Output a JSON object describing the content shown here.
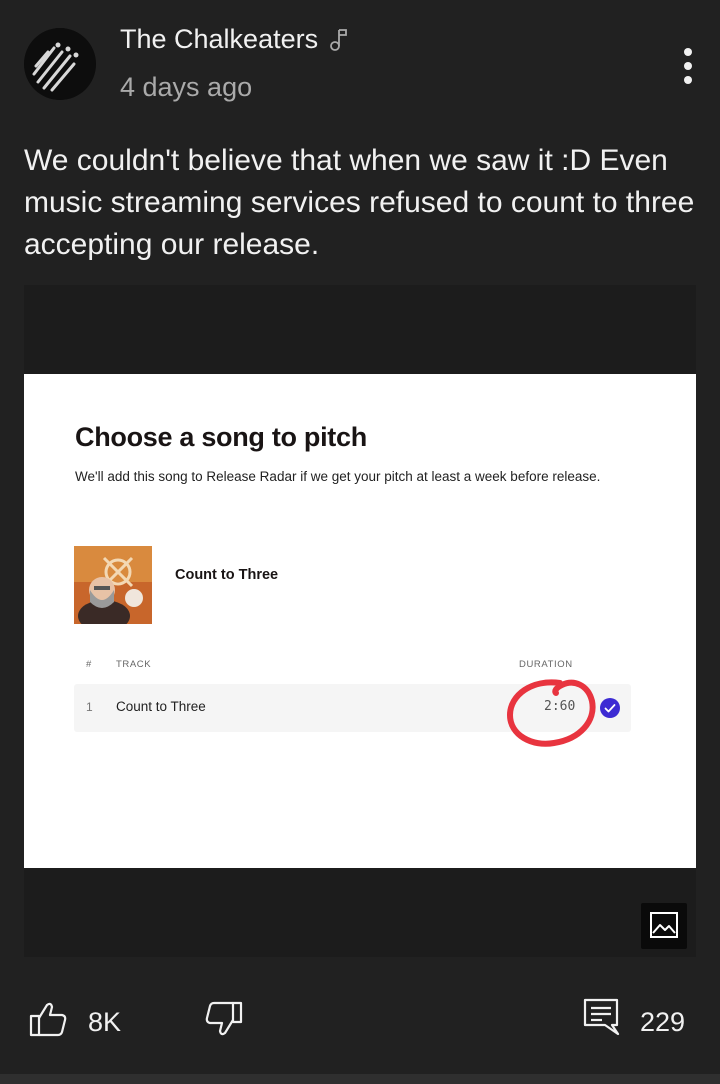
{
  "post": {
    "channel_name": "The Chalkeaters",
    "time": "4 days ago",
    "text": "We couldn't believe that when we saw it :D Even music streaming services refused to count to three accepting our release."
  },
  "screenshot": {
    "title": "Choose a song to pitch",
    "subtitle": "We'll add this song to Release Radar if we get your pitch at least a week before release.",
    "song_title": "Count to Three",
    "table": {
      "headers": {
        "num": "#",
        "track": "TRACK",
        "duration": "DURATION"
      },
      "rows": [
        {
          "num": "1",
          "title": "Count to Three",
          "duration": "2:60"
        }
      ]
    },
    "colors": {
      "check": "#3d2bd3",
      "circle": "#e8343f"
    }
  },
  "actions": {
    "likes": "8K",
    "comments": "229"
  },
  "icons": [
    "music-note-icon",
    "more-vert-icon",
    "image-icon",
    "thumbs-up-icon",
    "thumbs-down-icon",
    "comment-icon",
    "check-circle-icon"
  ]
}
